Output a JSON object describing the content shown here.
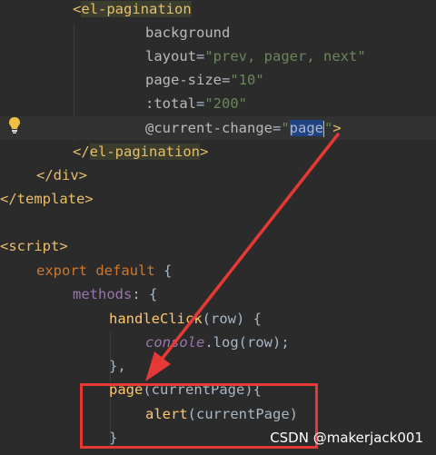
{
  "code": {
    "el_pagination_open": "el-pagination",
    "background_attr": "background",
    "layout_attr": "layout",
    "layout_value": "\"prev, pager, next\"",
    "page_size_attr": "page-size",
    "page_size_value": "\"10\"",
    "total_attr": ":total",
    "total_value": "\"200\"",
    "current_change_attr": "@current-change",
    "current_change_value": "page",
    "el_pagination_close": "el-pagination",
    "div_close": "div",
    "template_close": "template",
    "script_open": "script",
    "export_kw": "export default",
    "methods_prop": "methods",
    "handle_click_fn": "handleClick",
    "handle_click_param": "(row) {",
    "console_obj": "console",
    "log_call": ".log(row);",
    "close_comma": "},",
    "page_fn": "page",
    "page_param": "(currentPage){",
    "alert_fn": "alert",
    "alert_arg": "(currentPage)",
    "close_brace": "}"
  },
  "watermark": "CSDN @makerjack001",
  "colors": {
    "annotation": "#e53935",
    "background": "#2b2b2b"
  },
  "icons": {
    "gutter": "lightbulb-icon"
  }
}
